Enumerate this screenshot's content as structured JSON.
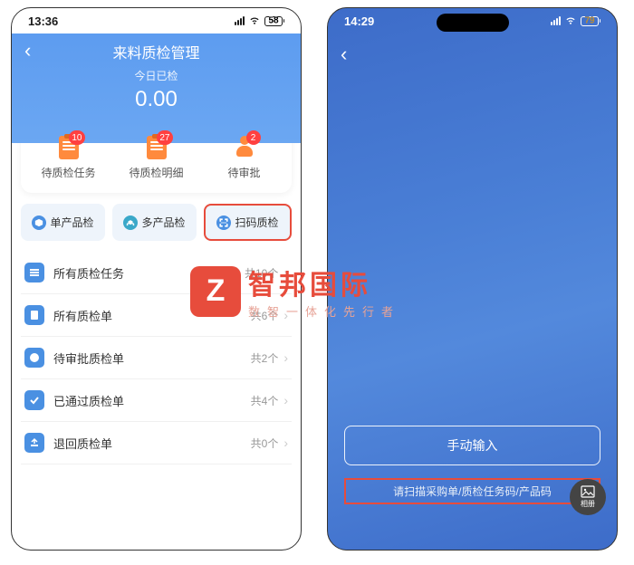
{
  "watermark": {
    "badge": "Z",
    "title": "智邦国际",
    "sub": "数智一体化先行者"
  },
  "left": {
    "status": {
      "time": "13:36",
      "battery": "58"
    },
    "header": {
      "title": "来料质检管理",
      "sub": "今日已检",
      "value": "0.00"
    },
    "stats": [
      {
        "label": "待质检任务",
        "badge": "10"
      },
      {
        "label": "待质检明细",
        "badge": "27"
      },
      {
        "label": "待审批",
        "badge": "2"
      }
    ],
    "pills": [
      {
        "label": "单产品检"
      },
      {
        "label": "多产品检"
      },
      {
        "label": "扫码质检"
      }
    ],
    "list": [
      {
        "label": "所有质检任务",
        "count": "共10个"
      },
      {
        "label": "所有质检单",
        "count": "共6个"
      },
      {
        "label": "待审批质检单",
        "count": "共2个"
      },
      {
        "label": "已通过质检单",
        "count": "共4个"
      },
      {
        "label": "退回质检单",
        "count": "共0个"
      }
    ]
  },
  "right": {
    "status": {
      "time": "14:29",
      "battery": "79"
    },
    "manual_label": "手动输入",
    "scan_tip": "请扫描采购单/质检任务码/产品码",
    "album_label": "相册"
  }
}
